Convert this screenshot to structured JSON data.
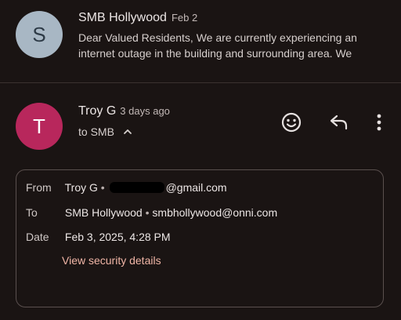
{
  "thread_item": {
    "avatar_letter": "S",
    "sender": "SMB Hollywood",
    "date": "Feb 2",
    "preview": "Dear Valued Residents, We are currently experiencing an internet outage in the building and surrounding area. We"
  },
  "message": {
    "avatar_letter": "T",
    "sender": "Troy G",
    "time_ago": "3 days ago",
    "to_label": "to SMB",
    "icons": [
      "emoji-icon",
      "reply-icon",
      "more-vert-icon",
      "chevron-up-icon"
    ]
  },
  "details": {
    "from_label": "From",
    "from_name": "Troy G",
    "from_email_suffix": "@gmail.com",
    "to_label": "To",
    "to_name": "SMB Hollywood",
    "to_email": "smbhollywood@onni.com",
    "date_label": "Date",
    "date_value": "Feb 3, 2025, 4:28 PM",
    "security_link": "View security details"
  },
  "colors": {
    "background": "#1a1413",
    "avatar_s": "#a8b7c4",
    "avatar_t": "#b8275c",
    "link": "#f0b5a6"
  }
}
